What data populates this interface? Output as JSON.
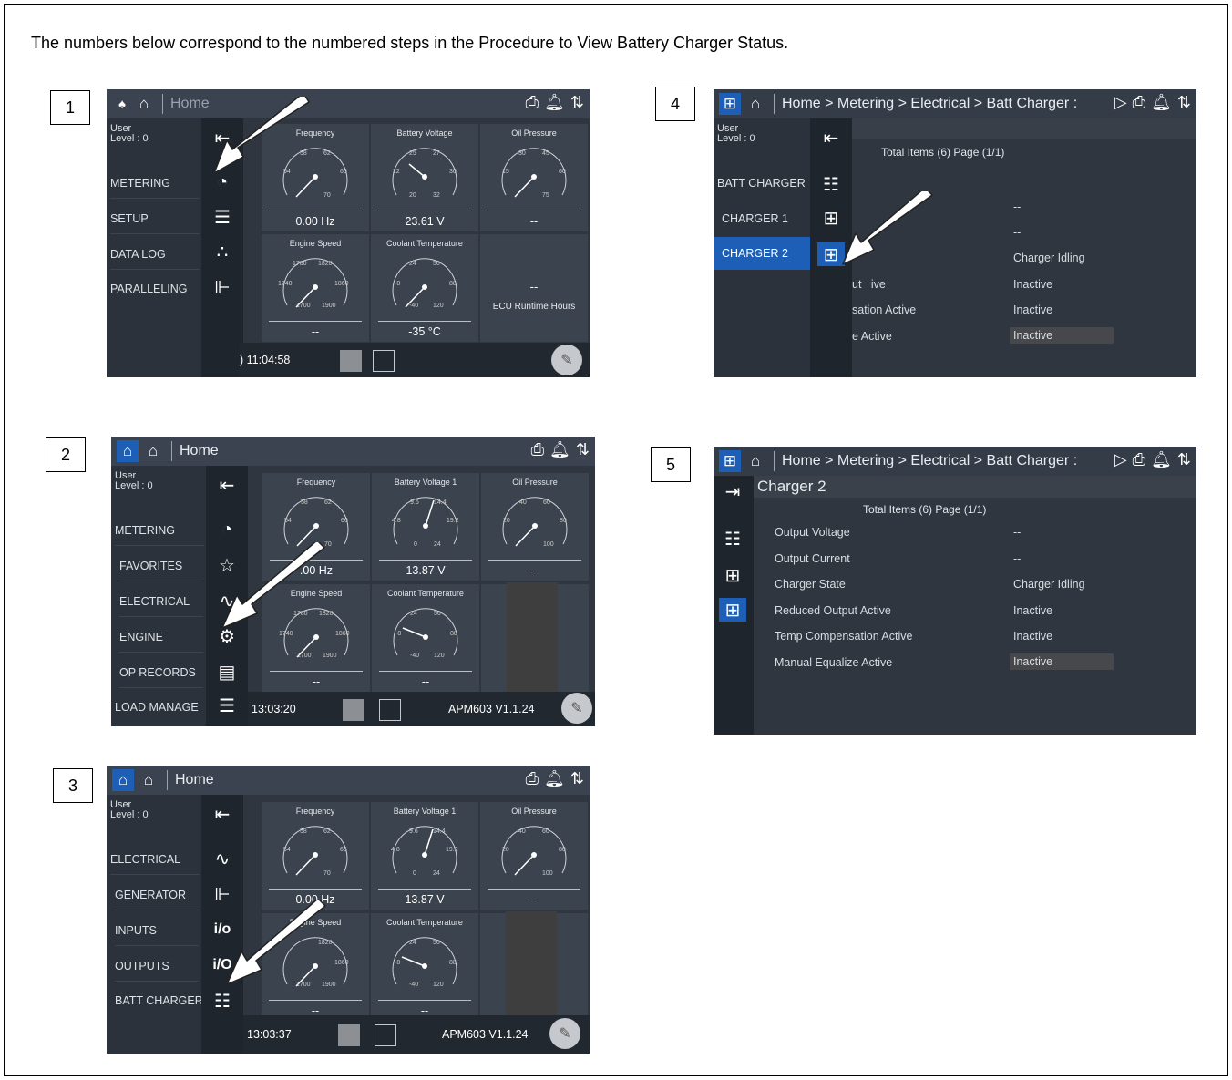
{
  "intro": "The numbers below correspond to the numbered steps in the Procedure to View Battery Charger Status.",
  "steps": [
    "1",
    "2",
    "3",
    "4",
    "5"
  ],
  "screen1": {
    "title": "Home",
    "user": "User",
    "level": "Level : 0",
    "menu": [
      "METERING",
      "SETUP",
      "DATA LOG",
      "PARALLELING"
    ],
    "icons": [
      "collapse-icon",
      "meter-gauge-icon",
      "sliders-icon",
      "dots-icon",
      "paralleling-icon"
    ],
    "gauges": [
      {
        "title": "Frequency",
        "value": "0.00 Hz",
        "ticks": [
          "54",
          "58",
          "62",
          "66",
          "70"
        ]
      },
      {
        "title": "Battery Voltage",
        "value": "23.61 V",
        "ticks": [
          "22",
          "25",
          "27",
          "30",
          "32",
          "20"
        ]
      },
      {
        "title": "Oil Pressure",
        "value": "--",
        "ticks": [
          "15",
          "30",
          "45",
          "60",
          "75"
        ]
      },
      {
        "title": "Engine Speed",
        "value": "--",
        "ticks": [
          "1740",
          "1780",
          "1820",
          "1860",
          "1900",
          "1700"
        ]
      },
      {
        "title": "Coolant Temperature",
        "value": "-35 °C",
        "ticks": [
          "-8",
          "24",
          "56",
          "88",
          "120",
          "-40"
        ]
      }
    ],
    "ecu_value": "--",
    "ecu_label": "ECU Runtime Hours",
    "time": ") 11:04:58"
  },
  "screen2": {
    "title": "Home",
    "user": "User",
    "level": "Level : 0",
    "menu": [
      "METERING",
      "FAVORITES",
      "ELECTRICAL",
      "ENGINE",
      "OP RECORDS",
      "LOAD MANAGE"
    ],
    "gauges": [
      {
        "title": "Frequency",
        "value": ".00 Hz"
      },
      {
        "title": "Battery Voltage 1",
        "value": "13.87 V"
      },
      {
        "title": "Oil Pressure",
        "value": "--"
      },
      {
        "title": "Engine Speed",
        "value": "--"
      },
      {
        "title": "Coolant Temperature",
        "value": "--"
      }
    ],
    "time": "13:03:20",
    "version": "APM603 V1.1.24"
  },
  "screen3": {
    "title": "Home",
    "user": "User",
    "level": "Level : 0",
    "menu": [
      "ELECTRICAL",
      "GENERATOR",
      "INPUTS",
      "OUTPUTS",
      "BATT CHARGER"
    ],
    "io1": "i/o",
    "io2": "i/O",
    "gauges": [
      {
        "title": "Frequency",
        "value": "0.00 Hz"
      },
      {
        "title": "Battery Voltage 1",
        "value": "13.87 V"
      },
      {
        "title": "Oil Pressure",
        "value": "--"
      },
      {
        "title": "Engine Speed",
        "value": "--"
      },
      {
        "title": "Coolant Temperature",
        "value": "--"
      }
    ],
    "time": "13:03:37",
    "version": "APM603 V1.1.24"
  },
  "screen4": {
    "breadcrumb": "Home > Metering > Electrical > Batt Charger :",
    "user": "User",
    "level": "Level : 0",
    "menu": [
      "BATT CHARGER",
      "CHARGER 1",
      "CHARGER 2"
    ],
    "total": "Total Items (6) Page (1/1)",
    "labels": [
      "",
      "",
      "",
      "ut   ive",
      "sation Active",
      "e Active"
    ],
    "values": [
      "--",
      "--",
      "Charger Idling",
      "Inactive",
      "Inactive",
      "Inactive"
    ]
  },
  "screen5": {
    "breadcrumb": "Home > Metering > Electrical > Batt Charger :",
    "heading": "Charger 2",
    "total": "Total Items (6) Page (1/1)",
    "labels": [
      "Output Voltage",
      "Output Current",
      "Charger State",
      "Reduced Output Active",
      "Temp Compensation Active",
      "Manual Equalize Active"
    ],
    "values": [
      "--",
      "--",
      "Charger Idling",
      "Inactive",
      "Inactive",
      "Inactive"
    ]
  },
  "colors": {
    "accent": "#1d5fb6",
    "screen_bg": "#2c333c",
    "tile": "#3b434e"
  }
}
